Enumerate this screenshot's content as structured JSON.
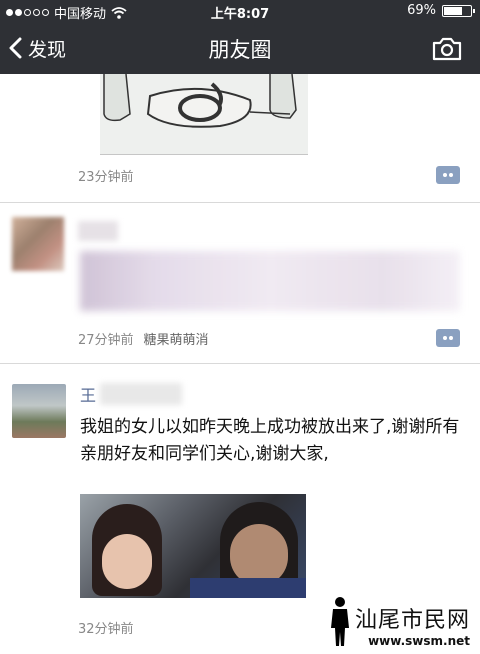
{
  "status_bar": {
    "carrier": "中国移动",
    "time": "上午8:07",
    "battery_text": "69%",
    "battery_level": 0.69,
    "signal_dots_filled": 2,
    "signal_dots_total": 5,
    "icons": [
      "wifi-icon",
      "battery-icon"
    ]
  },
  "nav": {
    "back_label": "发现",
    "title": "朋友圈",
    "icons": [
      "chevron-left-icon",
      "camera-icon"
    ]
  },
  "posts": [
    {
      "time": "23分钟前"
    },
    {
      "time": "27分钟前",
      "source": "糖果萌萌消"
    },
    {
      "name": "王",
      "text": "我姐的女儿以如昨天晚上成功被放出来了,谢谢所有亲朋好友和同学们关心,谢谢大家,",
      "time": "32分钟前"
    }
  ],
  "watermark": {
    "name": "汕尾市民网",
    "url": "www.swsm.net"
  },
  "colors": {
    "bar_bg": "#2e3035",
    "link_blue": "#576b95",
    "comment_btn": "#8aa0c0"
  }
}
